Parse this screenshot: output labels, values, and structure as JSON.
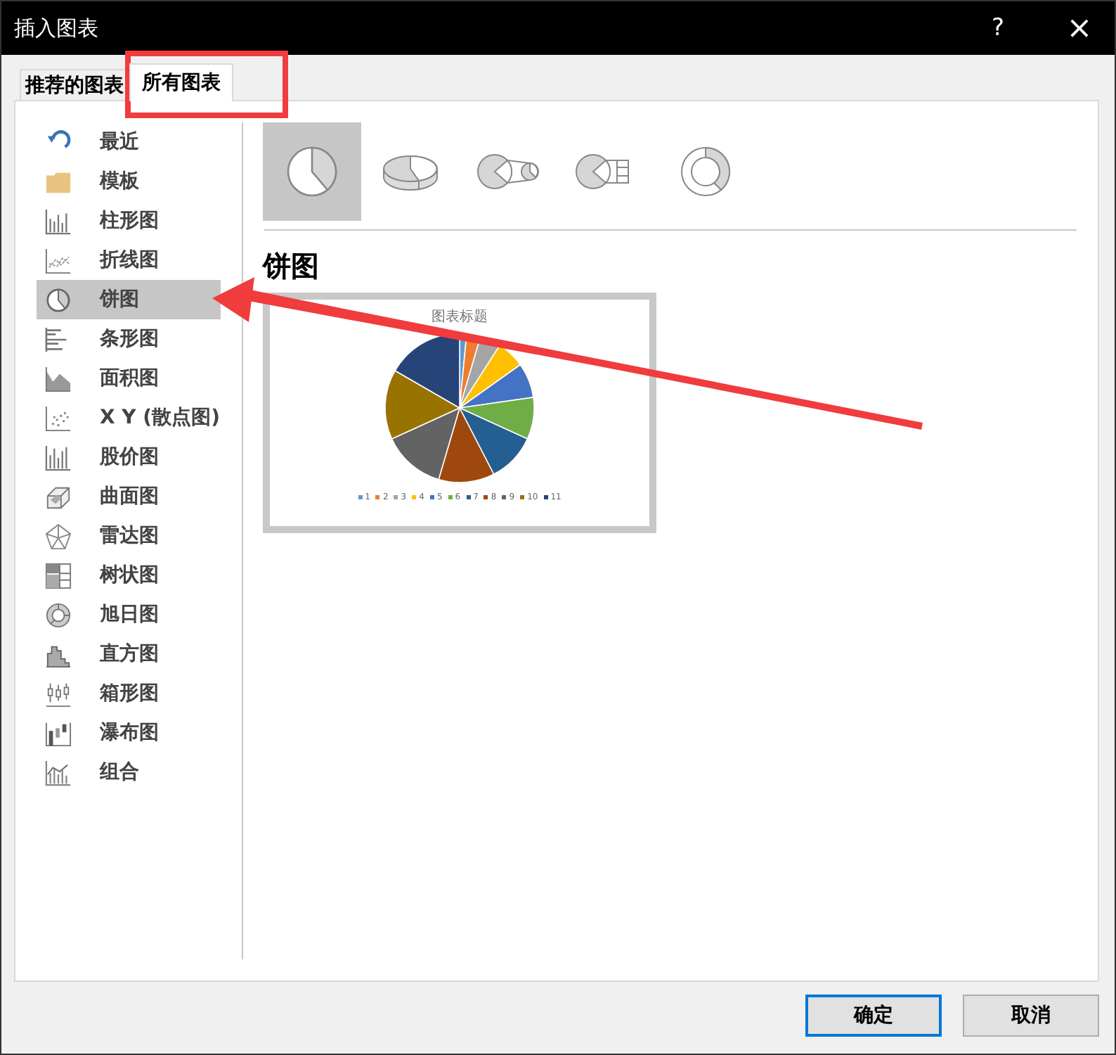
{
  "window": {
    "title": "插入图表",
    "help": "?",
    "close": "×"
  },
  "tabs": [
    {
      "label": "推荐的图表",
      "selected": false
    },
    {
      "label": "所有图表",
      "selected": true
    }
  ],
  "sidebar": {
    "items": [
      {
        "label": "最近",
        "kind": "recent",
        "selected": false
      },
      {
        "label": "模板",
        "kind": "template",
        "selected": false
      },
      {
        "label": "柱形图",
        "kind": "column",
        "selected": false
      },
      {
        "label": "折线图",
        "kind": "line",
        "selected": false
      },
      {
        "label": "饼图",
        "kind": "pie",
        "selected": true
      },
      {
        "label": "条形图",
        "kind": "bar",
        "selected": false
      },
      {
        "label": "面积图",
        "kind": "area",
        "selected": false
      },
      {
        "label": "X Y (散点图)",
        "kind": "scatter",
        "selected": false
      },
      {
        "label": "股价图",
        "kind": "stock",
        "selected": false
      },
      {
        "label": "曲面图",
        "kind": "surface",
        "selected": false
      },
      {
        "label": "雷达图",
        "kind": "radar",
        "selected": false
      },
      {
        "label": "树状图",
        "kind": "treemap",
        "selected": false
      },
      {
        "label": "旭日图",
        "kind": "sunburst",
        "selected": false
      },
      {
        "label": "直方图",
        "kind": "histogram",
        "selected": false
      },
      {
        "label": "箱形图",
        "kind": "box",
        "selected": false
      },
      {
        "label": "瀑布图",
        "kind": "waterfall",
        "selected": false
      },
      {
        "label": "组合",
        "kind": "combo",
        "selected": false
      }
    ]
  },
  "subtypes": [
    {
      "kind": "pie",
      "selected": true
    },
    {
      "kind": "pie3d",
      "selected": false
    },
    {
      "kind": "pie-of-pie",
      "selected": false
    },
    {
      "kind": "bar-of-pie",
      "selected": false
    },
    {
      "kind": "doughnut",
      "selected": false
    }
  ],
  "heading": "饼图",
  "preview": {
    "title": "图表标题",
    "legend": [
      {
        "label": "1",
        "color": "#5b9bd5"
      },
      {
        "label": "2",
        "color": "#ed7d31"
      },
      {
        "label": "3",
        "color": "#a5a5a5"
      },
      {
        "label": "4",
        "color": "#ffc000"
      },
      {
        "label": "5",
        "color": "#4472c4"
      },
      {
        "label": "6",
        "color": "#70ad47"
      },
      {
        "label": "7",
        "color": "#255e91"
      },
      {
        "label": "8",
        "color": "#9e480e"
      },
      {
        "label": "9",
        "color": "#636363"
      },
      {
        "label": "10",
        "color": "#997300"
      },
      {
        "label": "11",
        "color": "#264478"
      }
    ]
  },
  "buttons": [
    {
      "label": "确定",
      "default": true
    },
    {
      "label": "取消",
      "default": false
    }
  ]
}
